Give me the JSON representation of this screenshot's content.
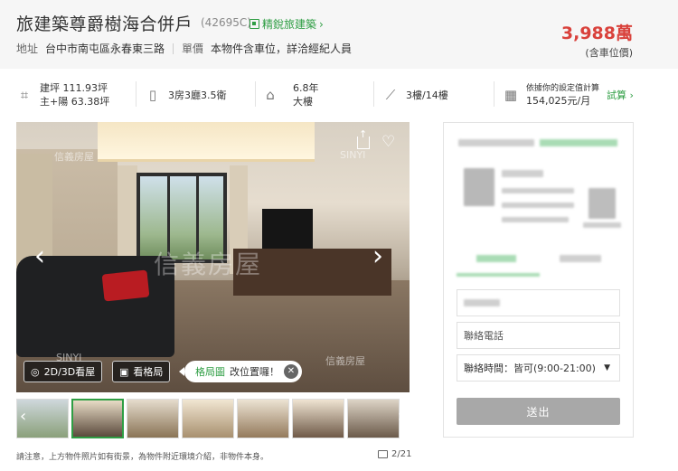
{
  "header": {
    "title": "旅建築尊爵樹海合併戶",
    "code": "(42695C)",
    "jingrui_link": "精銳旅建築",
    "address_label": "地址",
    "address": "台中市南屯區永春東三路",
    "unit_price_label": "單價",
    "unit_price": "本物件含車位，詳洽經紀人員",
    "price": "3,988萬",
    "price_note": "(含車位價)",
    "accent_green": "#2f9e44",
    "price_red": "#d9413b"
  },
  "specs": {
    "area_line1": "建坪  111.93坪",
    "area_line2": "主+陽  63.38坪",
    "layout": "3房3廳3.5衛",
    "age_line1": "6.8年",
    "age_line2": "大樓",
    "floor": "3樓/14樓",
    "calc_line1": "依據你的設定值計算",
    "calc_line2": "154,025元/月",
    "try_label": "試算"
  },
  "photo": {
    "watermark_top": "信義房屋",
    "watermark_brand": "SINYI",
    "watermark_center": "信義房屋",
    "watermark_bottom_left": "SINYI",
    "watermark_bottom_right": "信義房屋",
    "btn_3d": "2D/3D看屋",
    "btn_floorplan": "看格局",
    "hint_highlight": "格局圖",
    "hint_rest": "改位置囉！"
  },
  "thumbnails": {
    "count_visible": 8,
    "active_index": 1
  },
  "footer": {
    "note": "請注意，上方物件照片如有街景，為物件附近環境介紹，非物件本身。",
    "counter": "2/21"
  },
  "contact_form": {
    "phone_placeholder": "聯絡電話",
    "time_select": "聯絡時間：皆可(9:00-21:00)",
    "submit_label": "送出"
  }
}
